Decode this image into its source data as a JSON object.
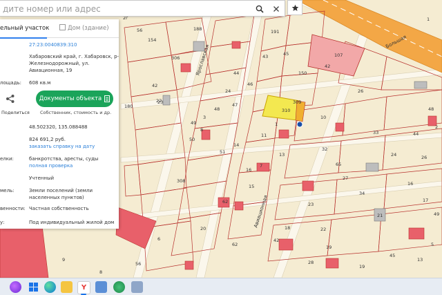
{
  "search": {
    "placeholder": "дите номер или адрес",
    "value": ""
  },
  "panel": {
    "tab_active": "ельный участок",
    "tab_inactive": "Дом (здание)",
    "cadastral_number": "27:23:0040839:310",
    "address": [
      "Хабаровский край, г. Хабаровск, р-н",
      "Железнодорожный, ул.",
      "Авиационная, 19"
    ],
    "area_label": "лощадь:",
    "area_value": "608 кв.м",
    "share_label": "Поделиться",
    "docs_button": "Документы объекта",
    "docs_sub": "Собственник, стоимость и др.",
    "coordinates": "48.502320, 135.088488",
    "cost_value": "824 691,2 руб.",
    "cost_link": "заказать справку на дату",
    "deals_label": "елки:",
    "deals_value": "банкротства, аресты, суды",
    "deals_link": "полная проверка",
    "status_value": "Учтенный",
    "land_label": "мель:",
    "land_value": [
      "Земли поселений (земли",
      "населенных пунктов)"
    ],
    "ownership_label": "венности:",
    "ownership_value": "Частная собственность",
    "use_label": "у:",
    "use_value": "Под индивидуальный жилой дом"
  },
  "map": {
    "street_labels": [
      "Ярославская",
      "Большая",
      "Авиационная"
    ],
    "parcel_labels": [
      "188",
      "191",
      "56",
      "154",
      "43",
      "45",
      "306",
      "150",
      "44",
      "46",
      "42",
      "23",
      "22",
      "180",
      "309",
      "310",
      "24",
      "48",
      "47",
      "3",
      "49",
      "8",
      "50",
      "11",
      "51",
      "14",
      "13",
      "16",
      "1",
      "7",
      "308",
      "62",
      "20",
      "15",
      "107",
      "42",
      "10",
      "26",
      "32",
      "33",
      "65",
      "27",
      "24",
      "34",
      "23",
      "22",
      "18",
      "19",
      "21",
      "42",
      "62",
      "16",
      "45",
      "17",
      "26",
      "44",
      "48",
      "49",
      "5",
      "8",
      "9",
      "2г",
      "2",
      "56",
      "1",
      "6",
      "28",
      "19",
      "13",
      "9"
    ]
  },
  "taskbar": {
    "icons": [
      "alice-icon",
      "windows-icon",
      "edge-icon",
      "files-icon",
      "yandex-browser-icon",
      "store-icon",
      "apps-icon",
      "settings-icon"
    ]
  },
  "colors": {
    "accent_green": "#1ba45a",
    "link_blue": "#2a7fd8",
    "selected_parcel": "#f3e850",
    "road": "#f0a335"
  }
}
